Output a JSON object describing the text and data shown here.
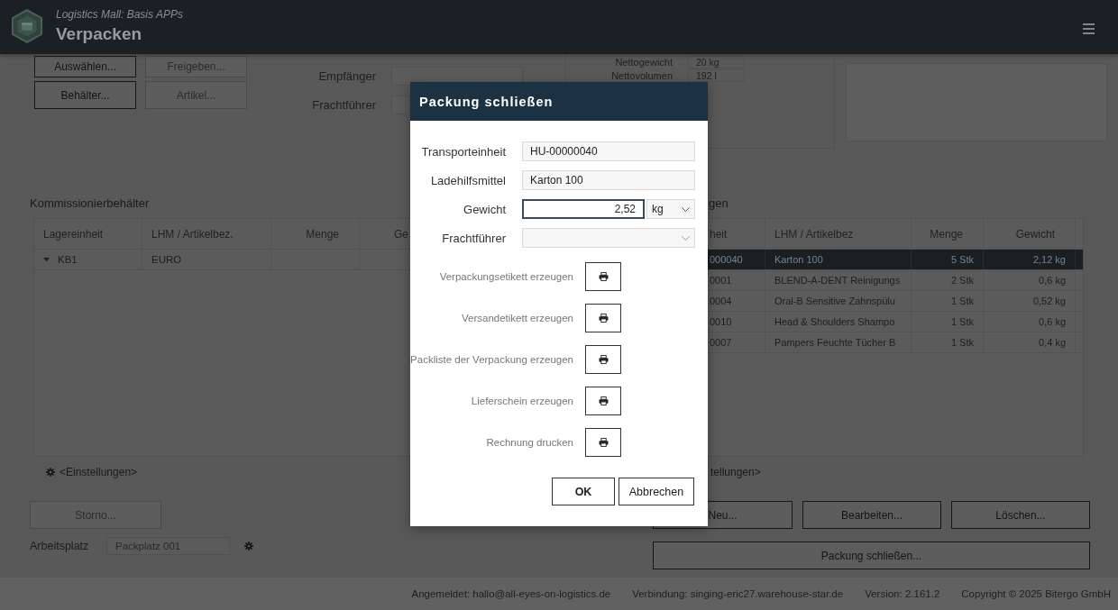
{
  "header": {
    "subtitle": "Logistics Mall: Basis APPs",
    "title": "Verpacken"
  },
  "toolbar_buttons": [
    {
      "label": "Auswählen...",
      "disabled": false
    },
    {
      "label": "Freigeben...",
      "disabled": true
    },
    {
      "label": "Behälter...",
      "disabled": false
    },
    {
      "label": "Artikel...",
      "disabled": true
    }
  ],
  "shipment_fields": [
    {
      "label": "Empfänger"
    },
    {
      "label": "Frachtführer"
    }
  ],
  "summary": [
    {
      "label": "Nettogewicht",
      "value": "20 kg"
    },
    {
      "label": "Nettovolumen",
      "value": "192 l"
    }
  ],
  "picking_containers": {
    "title": "Kommissionierbehälter",
    "columns": [
      "Lagereinheit",
      "LHM / Artikelbez.",
      "Menge",
      "Ge"
    ],
    "rows": [
      {
        "cells": [
          "KB1",
          "EURO"
        ],
        "expanded": true
      }
    ],
    "settings_link": "<Einstellungen>"
  },
  "packages": {
    "title": "gen",
    "columns": [
      "heit",
      "LHM / Artikelbez",
      "Menge",
      "Gewicht"
    ],
    "rows": [
      {
        "cells": [
          "000040",
          "Karton 100",
          "5 Stk",
          "2,12 kg"
        ],
        "selected": true
      },
      {
        "cells": [
          "0001",
          "BLEND-A-DENT Reinigungs",
          "2 Stk",
          "0,6 kg"
        ],
        "selected": false
      },
      {
        "cells": [
          "0004",
          "Oral-B Sensitive Zahnspülu",
          "1 Stk",
          "0,52 kg"
        ],
        "selected": false
      },
      {
        "cells": [
          "0010",
          "Head & Shoulders Shampo",
          "1 Stk",
          "0,6 kg"
        ],
        "selected": false
      },
      {
        "cells": [
          "0007",
          "Pampers Feuchte Tücher B",
          "1 Stk",
          "0,4 kg"
        ],
        "selected": false
      }
    ],
    "settings_link": "tellungen>"
  },
  "storno_button": {
    "label": "Storno...",
    "disabled": true
  },
  "workplace": {
    "label": "Arbeitsplatz",
    "value": "Packplatz 001"
  },
  "package_buttons": [
    "Neu...",
    "Bearbeiten...",
    "Löschen...",
    "Packung schließen..."
  ],
  "status_bar": [
    "Angemeldet: hallo@all-eyes-on-logistics.de",
    "Verbindung: singing-eric27.warehouse-star.de",
    "Version: 2.161.2",
    "Copyright © 2025 Bitergo GmbH"
  ],
  "dialog": {
    "title": "Packung schließen",
    "fields": [
      {
        "kind": "text",
        "label": "Transporteinheit",
        "value": "HU-00000040",
        "focused": false
      },
      {
        "kind": "text",
        "label": "Ladehilfsmittel",
        "value": "Karton 100",
        "focused": false
      },
      {
        "kind": "number_unit",
        "label": "Gewicht",
        "value": "2,52",
        "unit": "kg",
        "focused": true
      },
      {
        "kind": "select",
        "label": "Frachtführer",
        "focused": false
      }
    ],
    "print_actions": [
      "Verpackungsetikett erzeugen",
      "Versandetikett erzeugen",
      "Packliste der Verpackung erzeugen",
      "Lieferschein erzeugen",
      "Rechnung drucken"
    ],
    "buttons": [
      {
        "label": "OK",
        "default": true
      },
      {
        "label": "Abbrechen",
        "default": false
      }
    ]
  }
}
